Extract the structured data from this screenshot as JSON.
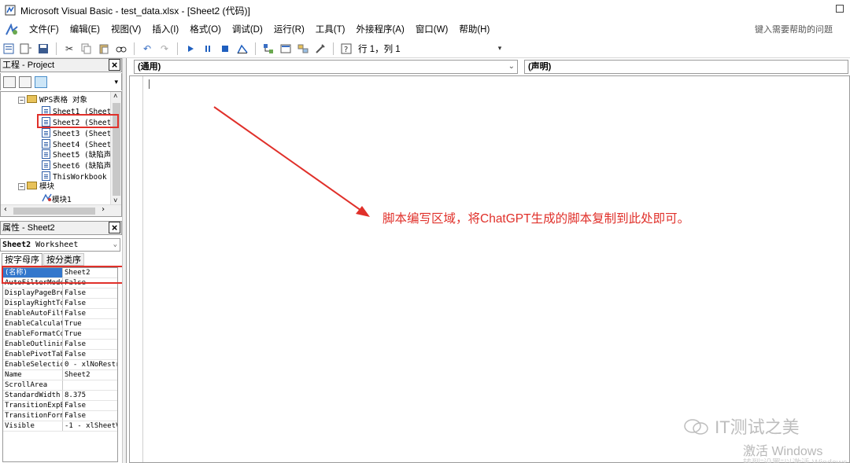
{
  "window": {
    "title": "Microsoft Visual Basic - test_data.xlsx - [Sheet2 (代码)]"
  },
  "menu": [
    "文件(F)",
    "编辑(E)",
    "视图(V)",
    "插入(I)",
    "格式(O)",
    "调试(D)",
    "运行(R)",
    "工具(T)",
    "外接程序(A)",
    "窗口(W)",
    "帮助(H)"
  ],
  "help_box": {
    "placeholder": "键入需要帮助的问题"
  },
  "toolbar": {
    "position": "行 1，列 1"
  },
  "project": {
    "title": "工程 - Project",
    "root": "WPS表格 对象",
    "sheets": [
      "Sheet1 (Sheet",
      "Sheet2 (Sheet",
      "Sheet3 (Sheet",
      "Sheet4 (Sheet",
      "Sheet5 (缺陷声",
      "Sheet6 (缺陷声",
      "ThisWorkbook"
    ],
    "modules_folder": "模块",
    "module": "模块1"
  },
  "properties": {
    "title": "属性 - Sheet2",
    "object_name": "Sheet2",
    "object_type": "Worksheet",
    "tabs": [
      "按字母序",
      "按分类序"
    ],
    "rows": [
      {
        "name": "(名称)",
        "value": "Sheet2"
      },
      {
        "name": "AutoFilterMode",
        "value": "False"
      },
      {
        "name": "DisplayPageBre",
        "value": "False"
      },
      {
        "name": "DisplayRightTo",
        "value": "False"
      },
      {
        "name": "EnableAutoFilt",
        "value": "False"
      },
      {
        "name": "EnableCalculat",
        "value": "True"
      },
      {
        "name": "EnableFormatCo",
        "value": "True"
      },
      {
        "name": "EnableOutlinin",
        "value": "False"
      },
      {
        "name": "EnablePivotTab",
        "value": "False"
      },
      {
        "name": "EnableSelectio",
        "value": "0 - xlNoRestr"
      },
      {
        "name": "Name",
        "value": "Sheet2"
      },
      {
        "name": "ScrollArea",
        "value": ""
      },
      {
        "name": "StandardWidth",
        "value": "8.375"
      },
      {
        "name": "TransitionExpE",
        "value": "False"
      },
      {
        "name": "TransitionForm",
        "value": "False"
      },
      {
        "name": "Visible",
        "value": "-1 - xlSheetV"
      }
    ]
  },
  "code": {
    "object_combo": "(通用)",
    "proc_combo": "(声明)"
  },
  "annotation": {
    "text": "脚本编写区域，将ChatGPT生成的脚本复制到此处即可。",
    "color": "#e0302a"
  },
  "watermark": {
    "text": "IT测试之美"
  },
  "activation": {
    "line1": "激活 Windows",
    "line2": "转到\"设置\"以激活 Windows。"
  }
}
